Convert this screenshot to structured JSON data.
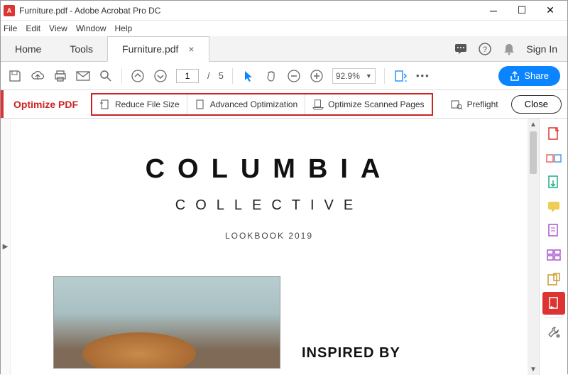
{
  "window": {
    "title": "Furniture.pdf - Adobe Acrobat Pro DC",
    "app_badge": "A"
  },
  "menu": {
    "items": [
      "File",
      "Edit",
      "View",
      "Window",
      "Help"
    ]
  },
  "tabs": {
    "home": "Home",
    "tools": "Tools",
    "doc": "Furniture.pdf",
    "signin": "Sign In"
  },
  "toolbar": {
    "page_current": "1",
    "page_sep": "/",
    "page_total": "5",
    "zoom": "92.9%",
    "more": "•••",
    "share": "Share"
  },
  "optimize": {
    "title": "Optimize PDF",
    "reduce": "Reduce File Size",
    "advanced": "Advanced Optimization",
    "scanned": "Optimize Scanned Pages",
    "preflight": "Preflight",
    "close": "Close"
  },
  "document": {
    "brand1": "COLUMBIA",
    "brand2": "COLLECTIVE",
    "sub": "LOOKBOOK 2019",
    "inspired": "INSPIRED BY"
  }
}
